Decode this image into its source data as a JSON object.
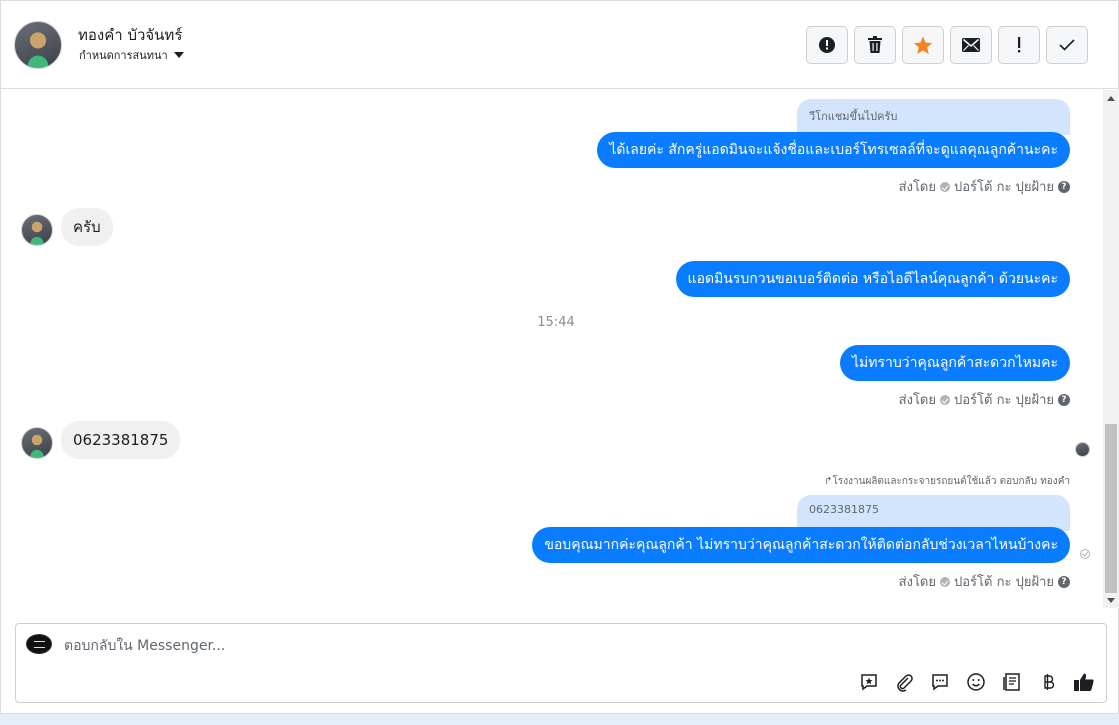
{
  "header": {
    "contact_name": "ทองคำ บัวจันทร์",
    "assign_label": "กำหนดการสนทนา"
  },
  "toolbar": {
    "buttons": [
      "mark-spam",
      "delete",
      "star",
      "mark-unread",
      "follow-up",
      "done"
    ],
    "star_color": "#f5821f"
  },
  "messages": {
    "m1": {
      "quoted": "วีโกแชมขึ้นไปครับ",
      "text": "ได้เลยค่ะ สักครู่แอดมินจะแจ้งชื่อและเบอร์โทรเซลล์ที่จะดูแลคุณลูกค้านะคะ",
      "sent_by_label": "ส่งโดย",
      "sender": "ปอร์โต้ กะ ปุยฝ้าย"
    },
    "m2": {
      "text": "ครับ"
    },
    "m3": {
      "text": "แอดมินรบกวนขอเบอร์ติดต่อ หรือไอดีไลน์คุณลูกค้า ด้วยนะคะ"
    },
    "time": "15:44",
    "m4": {
      "text": "ไม่ทราบว่าคุณลูกค้าสะดวกไหมคะ",
      "sent_by_label": "ส่งโดย",
      "sender": "ปอร์โต้ กะ ปุยฝ้าย"
    },
    "m5": {
      "text": "0623381875"
    },
    "m6": {
      "reply_note": "โรงงานผลิตและกระจายรถยนต์ใช้แล้ว ตอบกลับ ทองคำ",
      "quoted": "0623381875",
      "text": "ขอบคุณมากค่ะคุณลูกค้า ไม่ทราบว่าคุณลูกค้าสะดวกให้ติดต่อกลับช่วงเวลาไหนบ้างคะ",
      "sent_by_label": "ส่งโดย",
      "sender": "ปอร์โต้ กะ ปุยฝ้าย"
    }
  },
  "composer": {
    "placeholder": "ตอบกลับใน Messenger...",
    "icons": [
      "saved-reply-icon",
      "attachment-icon",
      "chat-bubble-icon",
      "emoji-icon",
      "notes-icon",
      "baht-icon",
      "like-icon"
    ]
  },
  "colors": {
    "outgoing_bubble": "#0a7cff",
    "incoming_bubble": "#f0f0f0",
    "quote_bubble": "#d3e5fc"
  }
}
